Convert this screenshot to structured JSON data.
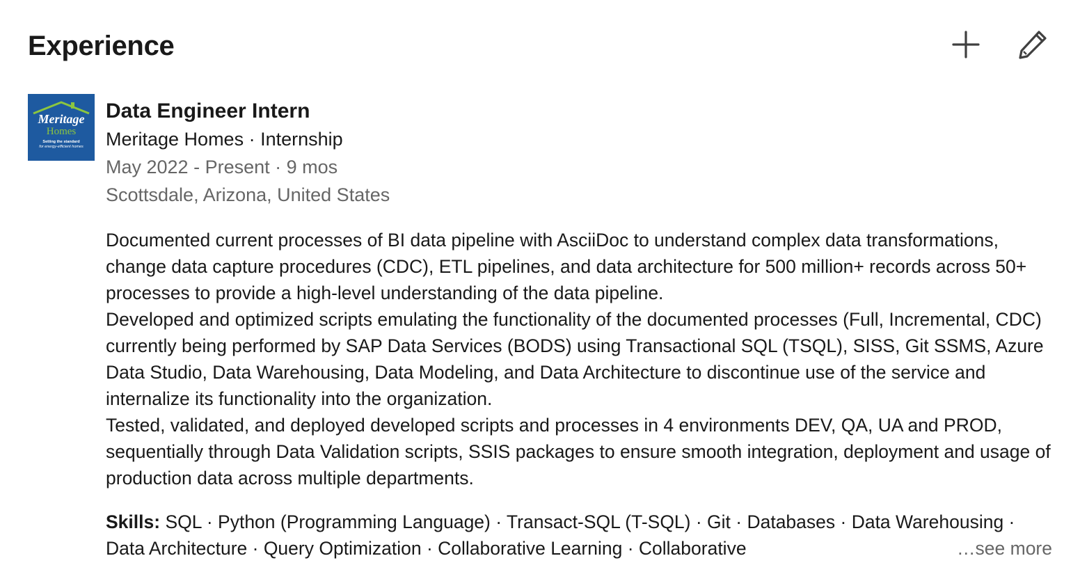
{
  "section": {
    "title": "Experience"
  },
  "actions": {
    "add_icon": "plus-icon",
    "edit_icon": "pencil-icon"
  },
  "entry": {
    "logo": {
      "brand_line1": "Meritage",
      "brand_line2": "Homes",
      "tagline1": "Setting the standard",
      "tagline2": "for energy-efficient homes",
      "bg_color": "#1e5aa0",
      "accent_color": "#8cc63f"
    },
    "title": "Data Engineer Intern",
    "company_line": "Meritage Homes · Internship",
    "dates": "May 2022 - Present · 9 mos",
    "location": "Scottsdale, Arizona, United States",
    "description": "Documented current processes of BI data pipeline with AsciiDoc to understand complex data transformations, change data capture procedures (CDC), ETL pipelines, and data architecture for 500 million+ records across 50+ processes to provide a high-level understanding of the data pipeline.\nDeveloped and optimized scripts emulating the functionality of the documented processes (Full, Incremental, CDC) currently being performed by SAP Data Services (BODS) using Transactional SQL (TSQL), SISS, Git SSMS, Azure Data Studio, Data Warehousing, Data Modeling, and Data Architecture to discontinue use of the service and internalize its functionality into the organization.\nTested, validated, and deployed developed scripts and processes in 4 environments DEV, QA, UA and PROD, sequentially through Data Validation scripts, SSIS packages to ensure smooth integration, deployment and usage of production data across multiple departments.",
    "skills_label": "Skills:",
    "skills_text": " SQL · Python (Programming Language) · Transact-SQL (T-SQL) · Git · Databases · Data Warehousing · Data Architecture · Query Optimization · Collaborative Learning · Collaborative",
    "see_more": "…see more"
  }
}
